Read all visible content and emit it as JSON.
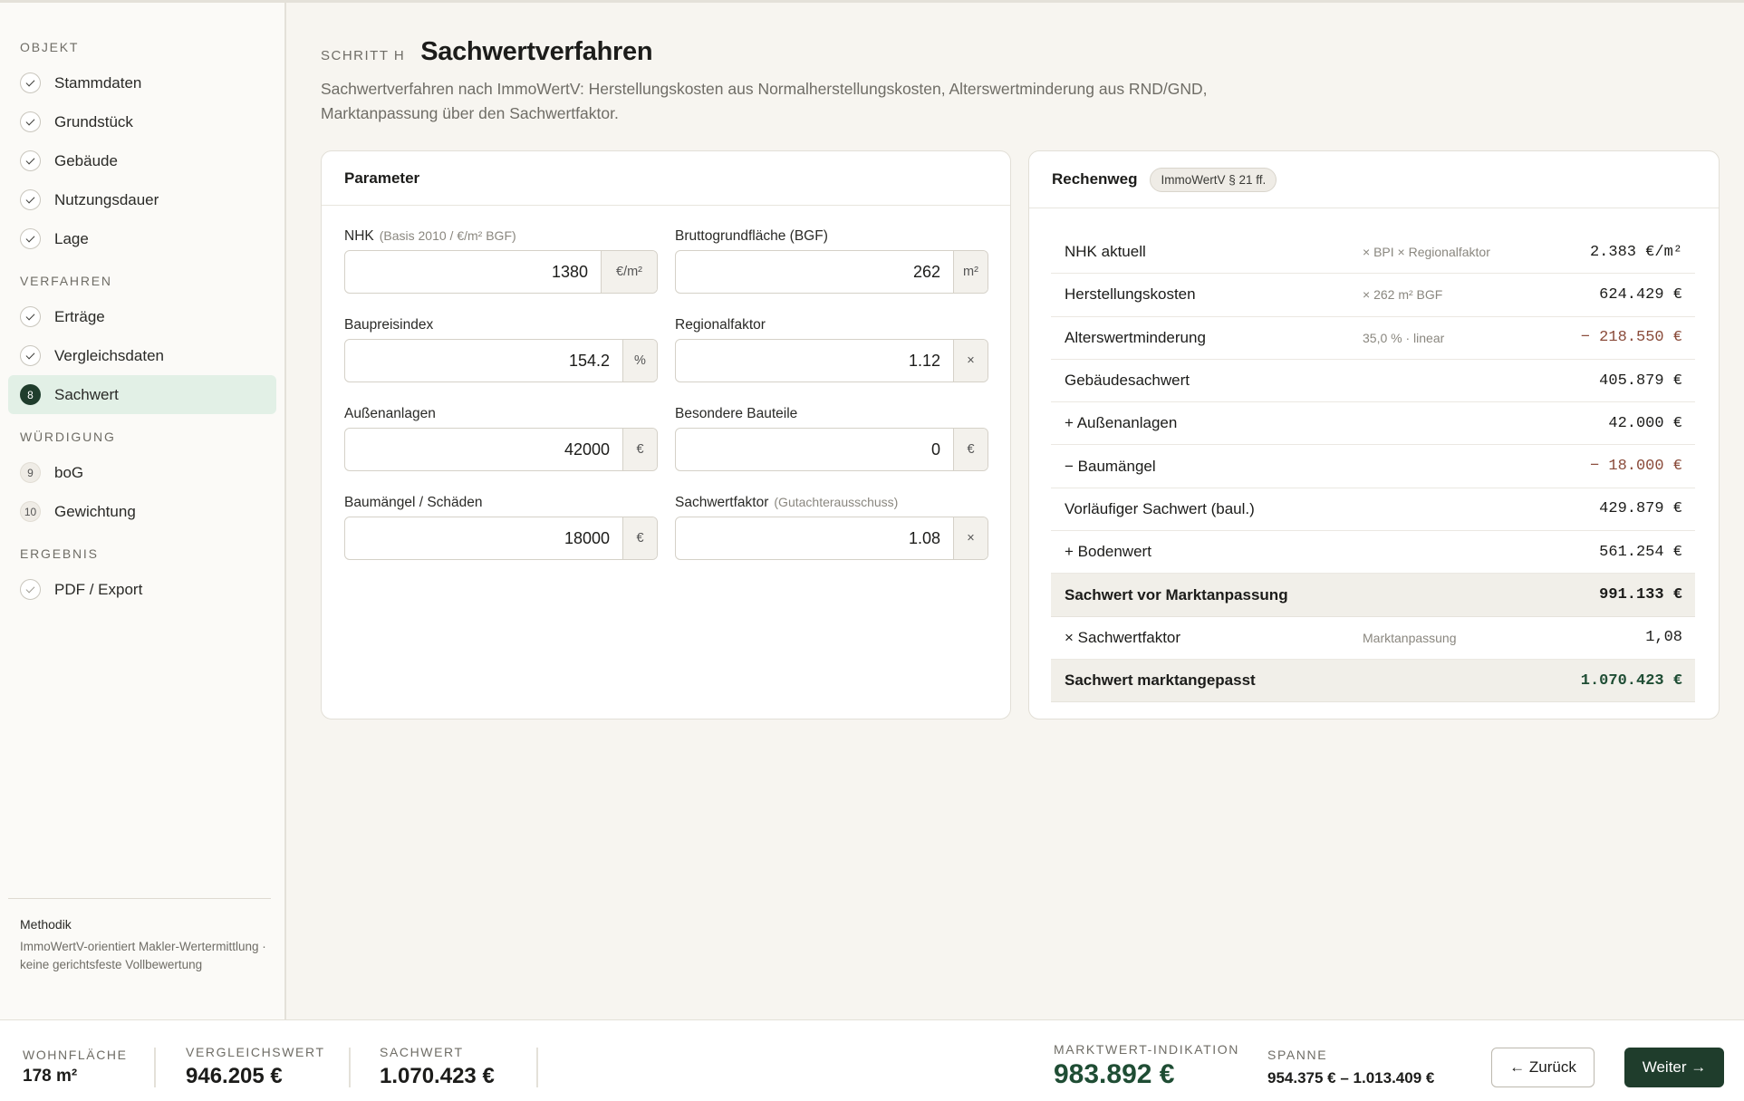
{
  "sidebar": {
    "sections": [
      {
        "title": "OBJEKT",
        "items": [
          {
            "label": "Stammdaten",
            "badge": "",
            "state": "done"
          },
          {
            "label": "Grundstück",
            "badge": "",
            "state": "done"
          },
          {
            "label": "Gebäude",
            "badge": "",
            "state": "done"
          },
          {
            "label": "Nutzungsdauer",
            "badge": "",
            "state": "done"
          },
          {
            "label": "Lage",
            "badge": "",
            "state": "done"
          }
        ]
      },
      {
        "title": "VERFAHREN",
        "items": [
          {
            "label": "Erträge",
            "badge": "",
            "state": "done"
          },
          {
            "label": "Vergleichsdaten",
            "badge": "",
            "state": "done"
          },
          {
            "label": "Sachwert",
            "badge": "8",
            "state": "active"
          }
        ]
      },
      {
        "title": "WÜRDIGUNG",
        "items": [
          {
            "label": "boG",
            "badge": "9",
            "state": "todo"
          },
          {
            "label": "Gewichtung",
            "badge": "10",
            "state": "todo"
          }
        ]
      },
      {
        "title": "ERGEBNIS",
        "items": [
          {
            "label": "PDF / Export",
            "badge": "",
            "state": "done-muted"
          }
        ]
      }
    ],
    "footer": {
      "title": "Methodik",
      "text": "ImmoWertV-orientiert Makler-Wertermittlung · keine gerichtsfeste Vollbewertung"
    }
  },
  "header": {
    "step": "SCHRITT H",
    "title": "Sachwertverfahren",
    "description": "Sachwertverfahren nach ImmoWertV: Herstellungskosten aus Normalherstellungskosten, Alterswertminderung aus RND/GND, Marktanpassung über den Sachwertfaktor."
  },
  "params": {
    "title": "Parameter",
    "fields": {
      "nhk": {
        "label": "NHK",
        "hint": "(Basis 2010 / €/m² BGF)",
        "value": "1380",
        "unit": "€/m²"
      },
      "bgf": {
        "label": "Bruttogrundfläche (BGF)",
        "hint": "",
        "value": "262",
        "unit": "m²"
      },
      "bpi": {
        "label": "Baupreisindex",
        "hint": "",
        "value": "154.2",
        "unit": "%"
      },
      "regional": {
        "label": "Regionalfaktor",
        "hint": "",
        "value": "1.12",
        "unit": "×"
      },
      "aussen": {
        "label": "Außenanlagen",
        "hint": "",
        "value": "42000",
        "unit": "€"
      },
      "bauteile": {
        "label": "Besondere Bauteile",
        "hint": "",
        "value": "0",
        "unit": "€"
      },
      "maengel": {
        "label": "Baumängel / Schäden",
        "hint": "",
        "value": "18000",
        "unit": "€"
      },
      "faktor": {
        "label": "Sachwertfaktor",
        "hint": "(Gutachterausschuss)",
        "value": "1.08",
        "unit": "×"
      }
    }
  },
  "calc": {
    "title": "Rechenweg",
    "badge": "ImmoWertV § 21 ff.",
    "rows": [
      {
        "label": "NHK aktuell",
        "note": "× BPI × Regionalfaktor",
        "value": "2.383 €/m²",
        "style": ""
      },
      {
        "label": "Herstellungskosten",
        "note": "× 262 m² BGF",
        "value": "624.429 €",
        "style": ""
      },
      {
        "label": "Alterswertminderung",
        "note": "35,0 % · linear",
        "value": "− 218.550 €",
        "style": "neg"
      },
      {
        "label": "Gebäudesachwert",
        "note": "",
        "value": "405.879 €",
        "style": ""
      },
      {
        "label": "+ Außenanlagen",
        "note": "",
        "value": "42.000 €",
        "style": ""
      },
      {
        "label": "− Baumängel",
        "note": "",
        "value": "− 18.000 €",
        "style": "neg"
      },
      {
        "label": "Vorläufiger Sachwert (baul.)",
        "note": "",
        "value": "429.879 €",
        "style": ""
      },
      {
        "label": "+ Bodenwert",
        "note": "",
        "value": "561.254 €",
        "style": ""
      },
      {
        "label": "Sachwert vor Marktanpassung",
        "note": "",
        "value": "991.133 €",
        "style": "total"
      },
      {
        "label": "× Sachwertfaktor",
        "note": "Marktanpassung",
        "value": "1,08",
        "style": ""
      },
      {
        "label": "Sachwert marktangepasst",
        "note": "",
        "value": "1.070.423 €",
        "style": "total-pos"
      }
    ]
  },
  "footer": {
    "wohnflaeche": {
      "label": "WOHNFLÄCHE",
      "value": "178 m²"
    },
    "vergleichswert": {
      "label": "VERGLEICHSWERT",
      "value": "946.205 €"
    },
    "sachwert": {
      "label": "SACHWERT",
      "value": "1.070.423 €"
    },
    "marktwert": {
      "label": "MARKTWERT-INDIKATION",
      "value": "983.892 €"
    },
    "spanne": {
      "label": "SPANNE",
      "value": "954.375 € – 1.013.409 €"
    },
    "back_label": "← Zurück",
    "next_label": "Weiter →"
  },
  "colors": {
    "accent": "#1f3d2c",
    "active_bg": "#e2f0e6",
    "negative": "#8a4b3a",
    "positive": "#1f4d34"
  }
}
